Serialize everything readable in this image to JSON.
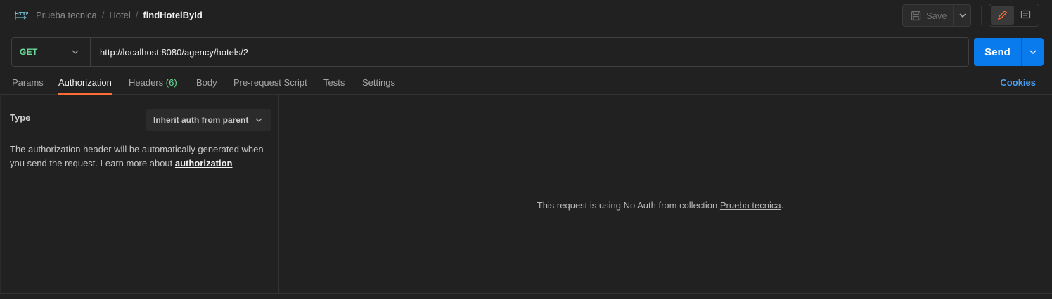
{
  "header": {
    "breadcrumb": [
      "Prueba tecnica",
      "Hotel"
    ],
    "separator": "/",
    "current": "findHotelById",
    "save_label": "Save"
  },
  "request": {
    "method": "GET",
    "url": "http://localhost:8080/agency/hotels/2",
    "send_label": "Send"
  },
  "tabs": {
    "params": "Params",
    "authorization": "Authorization",
    "headers": "Headers",
    "headers_count": "(6)",
    "body": "Body",
    "prerequest": "Pre-request Script",
    "tests": "Tests",
    "settings": "Settings",
    "cookies": "Cookies"
  },
  "auth": {
    "type_label": "Type",
    "type_value": "Inherit auth from parent",
    "description": "The authorization header will be automatically generated when you send the request. Learn more about ",
    "link": "authorization",
    "status_prefix": "This request is using No Auth from collection ",
    "status_collection": "Prueba tecnica",
    "status_suffix": "."
  },
  "colors": {
    "background": "#212121",
    "accent_orange": "#ff6c37",
    "send_blue": "#097bed",
    "method_green": "#6bdd9a",
    "link_blue": "#4a9cf0"
  },
  "icons": [
    "http-icon",
    "save-icon",
    "chevron-down-icon",
    "pencil-icon",
    "comment-icon"
  ]
}
